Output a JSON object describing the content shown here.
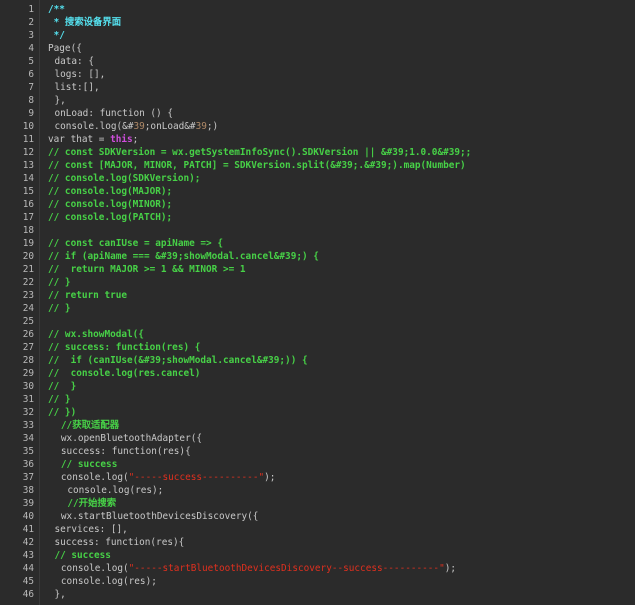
{
  "editor": {
    "background": "#2b2b2b",
    "colors": {
      "plain": "#c8c8c8",
      "comment": "#47d147",
      "doc": "#55e0ee",
      "keyword": "#cf4edc",
      "number": "#b08a68",
      "string": "#e0301f"
    },
    "lines": [
      {
        "n": "1",
        "indent": 1,
        "segs": [
          {
            "t": "/**",
            "c": "doc"
          }
        ]
      },
      {
        "n": "2",
        "indent": 1,
        "segs": [
          {
            "t": " * 搜索设备界面",
            "c": "doc"
          }
        ]
      },
      {
        "n": "3",
        "indent": 1,
        "segs": [
          {
            "t": " */",
            "c": "doc"
          }
        ]
      },
      {
        "n": "4",
        "indent": 1,
        "segs": [
          {
            "t": "Page({",
            "c": "plain"
          }
        ]
      },
      {
        "n": "5",
        "indent": 2,
        "segs": [
          {
            "t": "data: {",
            "c": "plain"
          }
        ]
      },
      {
        "n": "6",
        "indent": 2,
        "segs": [
          {
            "t": "logs: [],",
            "c": "plain"
          }
        ]
      },
      {
        "n": "7",
        "indent": 2,
        "segs": [
          {
            "t": "list:[],",
            "c": "plain"
          }
        ]
      },
      {
        "n": "8",
        "indent": 2,
        "segs": [
          {
            "t": "},",
            "c": "plain"
          }
        ]
      },
      {
        "n": "9",
        "indent": 2,
        "segs": [
          {
            "t": "onLoad: function () {",
            "c": "plain"
          }
        ]
      },
      {
        "n": "10",
        "indent": 2,
        "segs": [
          {
            "t": "console.log(&#",
            "c": "plain"
          },
          {
            "t": "39",
            "c": "number"
          },
          {
            "t": ";onLoad&#",
            "c": "plain"
          },
          {
            "t": "39",
            "c": "number"
          },
          {
            "t": ";)",
            "c": "plain"
          }
        ]
      },
      {
        "n": "11",
        "indent": 1,
        "segs": [
          {
            "t": "var that = ",
            "c": "plain"
          },
          {
            "t": "this",
            "c": "keyword"
          },
          {
            "t": ";",
            "c": "plain"
          }
        ]
      },
      {
        "n": "12",
        "indent": 1,
        "segs": [
          {
            "t": "// const SDKVersion = wx.getSystemInfoSync().SDKVersion || &#39;1.0.0&#39;;",
            "c": "comment"
          }
        ]
      },
      {
        "n": "13",
        "indent": 1,
        "segs": [
          {
            "t": "// const [MAJOR, MINOR, PATCH] = SDKVersion.split(&#39;.&#39;).map(Number)",
            "c": "comment"
          }
        ]
      },
      {
        "n": "14",
        "indent": 1,
        "segs": [
          {
            "t": "// console.log(SDKVersion);",
            "c": "comment"
          }
        ]
      },
      {
        "n": "15",
        "indent": 1,
        "segs": [
          {
            "t": "// console.log(MAJOR);",
            "c": "comment"
          }
        ]
      },
      {
        "n": "16",
        "indent": 1,
        "segs": [
          {
            "t": "// console.log(MINOR);",
            "c": "comment"
          }
        ]
      },
      {
        "n": "17",
        "indent": 1,
        "segs": [
          {
            "t": "// console.log(PATCH);",
            "c": "comment"
          }
        ]
      },
      {
        "n": "18",
        "indent": 1,
        "segs": []
      },
      {
        "n": "19",
        "indent": 1,
        "segs": [
          {
            "t": "// const canIUse = apiName => {",
            "c": "comment"
          }
        ]
      },
      {
        "n": "20",
        "indent": 1,
        "segs": [
          {
            "t": "// if (apiName === &#39;showModal.cancel&#39;) {",
            "c": "comment"
          }
        ]
      },
      {
        "n": "21",
        "indent": 1,
        "segs": [
          {
            "t": "//  return MAJOR >= 1 && MINOR >= 1",
            "c": "comment"
          }
        ]
      },
      {
        "n": "22",
        "indent": 1,
        "segs": [
          {
            "t": "// }",
            "c": "comment"
          }
        ]
      },
      {
        "n": "23",
        "indent": 1,
        "segs": [
          {
            "t": "// return true",
            "c": "comment"
          }
        ]
      },
      {
        "n": "24",
        "indent": 1,
        "segs": [
          {
            "t": "// }",
            "c": "comment"
          }
        ]
      },
      {
        "n": "25",
        "indent": 1,
        "segs": []
      },
      {
        "n": "26",
        "indent": 1,
        "segs": [
          {
            "t": "// wx.showModal({",
            "c": "comment"
          }
        ]
      },
      {
        "n": "27",
        "indent": 1,
        "segs": [
          {
            "t": "// success: function(res) {",
            "c": "comment"
          }
        ]
      },
      {
        "n": "28",
        "indent": 1,
        "segs": [
          {
            "t": "//  if (canIUse(&#39;showModal.cancel&#39;)) {",
            "c": "comment"
          }
        ]
      },
      {
        "n": "29",
        "indent": 1,
        "segs": [
          {
            "t": "//  console.log(res.cancel)",
            "c": "comment"
          }
        ]
      },
      {
        "n": "30",
        "indent": 1,
        "segs": [
          {
            "t": "//  }",
            "c": "comment"
          }
        ]
      },
      {
        "n": "31",
        "indent": 1,
        "segs": [
          {
            "t": "// }",
            "c": "comment"
          }
        ]
      },
      {
        "n": "32",
        "indent": 1,
        "segs": [
          {
            "t": "// })",
            "c": "comment"
          }
        ]
      },
      {
        "n": "33",
        "indent": 3,
        "segs": [
          {
            "t": "//获取适配器",
            "c": "comment"
          }
        ]
      },
      {
        "n": "34",
        "indent": 3,
        "segs": [
          {
            "t": "wx.openBluetoothAdapter({",
            "c": "plain"
          }
        ]
      },
      {
        "n": "35",
        "indent": 3,
        "segs": [
          {
            "t": "success: function(res){",
            "c": "plain"
          }
        ]
      },
      {
        "n": "36",
        "indent": 3,
        "segs": [
          {
            "t": "// success",
            "c": "comment"
          }
        ]
      },
      {
        "n": "37",
        "indent": 3,
        "segs": [
          {
            "t": "console.log(",
            "c": "plain"
          },
          {
            "t": "\"-----success----------\"",
            "c": "string"
          },
          {
            "t": ");",
            "c": "plain"
          }
        ]
      },
      {
        "n": "38",
        "indent": 4,
        "segs": [
          {
            "t": "console.log(res);",
            "c": "plain"
          }
        ]
      },
      {
        "n": "39",
        "indent": 4,
        "segs": [
          {
            "t": "//开始搜索",
            "c": "comment"
          }
        ]
      },
      {
        "n": "40",
        "indent": 3,
        "segs": [
          {
            "t": "wx.startBluetoothDevicesDiscovery({",
            "c": "plain"
          }
        ]
      },
      {
        "n": "41",
        "indent": 2,
        "segs": [
          {
            "t": "services: [],",
            "c": "plain"
          }
        ]
      },
      {
        "n": "42",
        "indent": 2,
        "segs": [
          {
            "t": "success: function(res){",
            "c": "plain"
          }
        ]
      },
      {
        "n": "43",
        "indent": 2,
        "segs": [
          {
            "t": "// success",
            "c": "comment"
          }
        ]
      },
      {
        "n": "44",
        "indent": 3,
        "segs": [
          {
            "t": "console.log(",
            "c": "plain"
          },
          {
            "t": "\"-----startBluetoothDevicesDiscovery--success----------\"",
            "c": "string"
          },
          {
            "t": ");",
            "c": "plain"
          }
        ]
      },
      {
        "n": "45",
        "indent": 3,
        "segs": [
          {
            "t": "console.log(res);",
            "c": "plain"
          }
        ]
      },
      {
        "n": "46",
        "indent": 2,
        "segs": [
          {
            "t": "},",
            "c": "plain"
          }
        ]
      }
    ]
  }
}
